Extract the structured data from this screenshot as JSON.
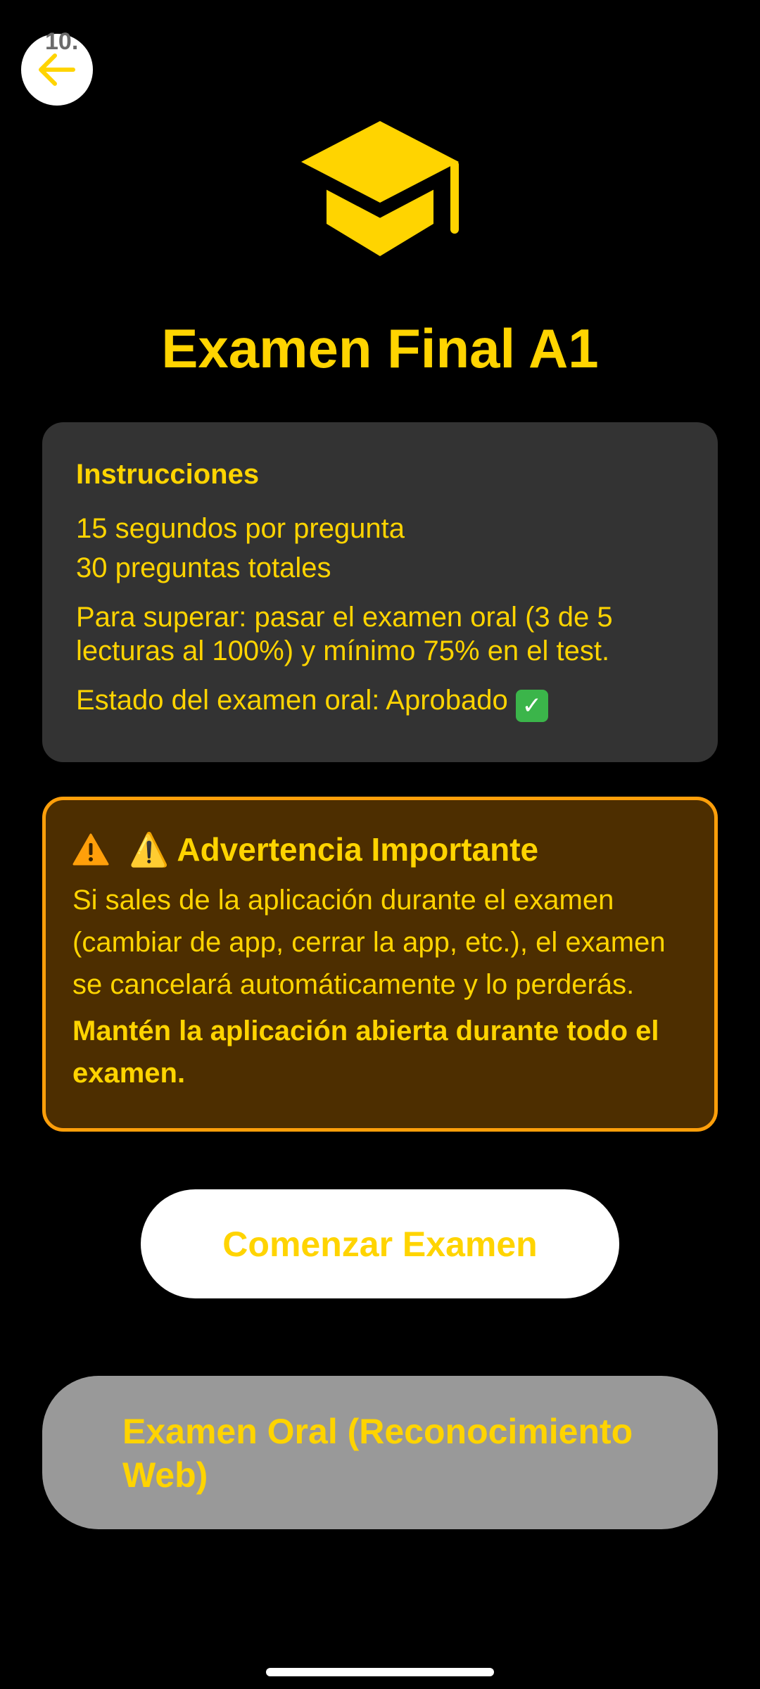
{
  "status_overlay": "10.",
  "header": {
    "back_icon": "arrow-left-icon",
    "logo_icon": "graduation-cap-icon",
    "title": "Examen Final A1"
  },
  "instructions": {
    "heading": "Instrucciones",
    "line1": "15 segundos por pregunta",
    "line2": "30 preguntas totales",
    "pass_rule": "Para superar: pasar el examen oral (3 de 5 lecturas al 100%) y mínimo 75% en el test.",
    "oral_status": "Estado del examen oral: Aprobado",
    "status_icon": "check-mark-button-icon"
  },
  "warning": {
    "title": "⚠️ Advertencia Importante",
    "text": "Si sales de la aplicación durante el examen (cambiar de app, cerrar la app, etc.), el examen se cancelará automáticamente y lo perderás.",
    "bold_text": "Mantén la aplicación abierta durante todo el examen."
  },
  "actions": {
    "start_label": "Comenzar Examen",
    "oral_label": "Examen Oral (Reconocimiento Web)"
  },
  "colors": {
    "accent": "#ffd400",
    "background": "#000000",
    "card": "#333333",
    "warning_bg": "#4d2e00",
    "warning_border": "#ff9f0a",
    "disabled_button": "#999999"
  }
}
